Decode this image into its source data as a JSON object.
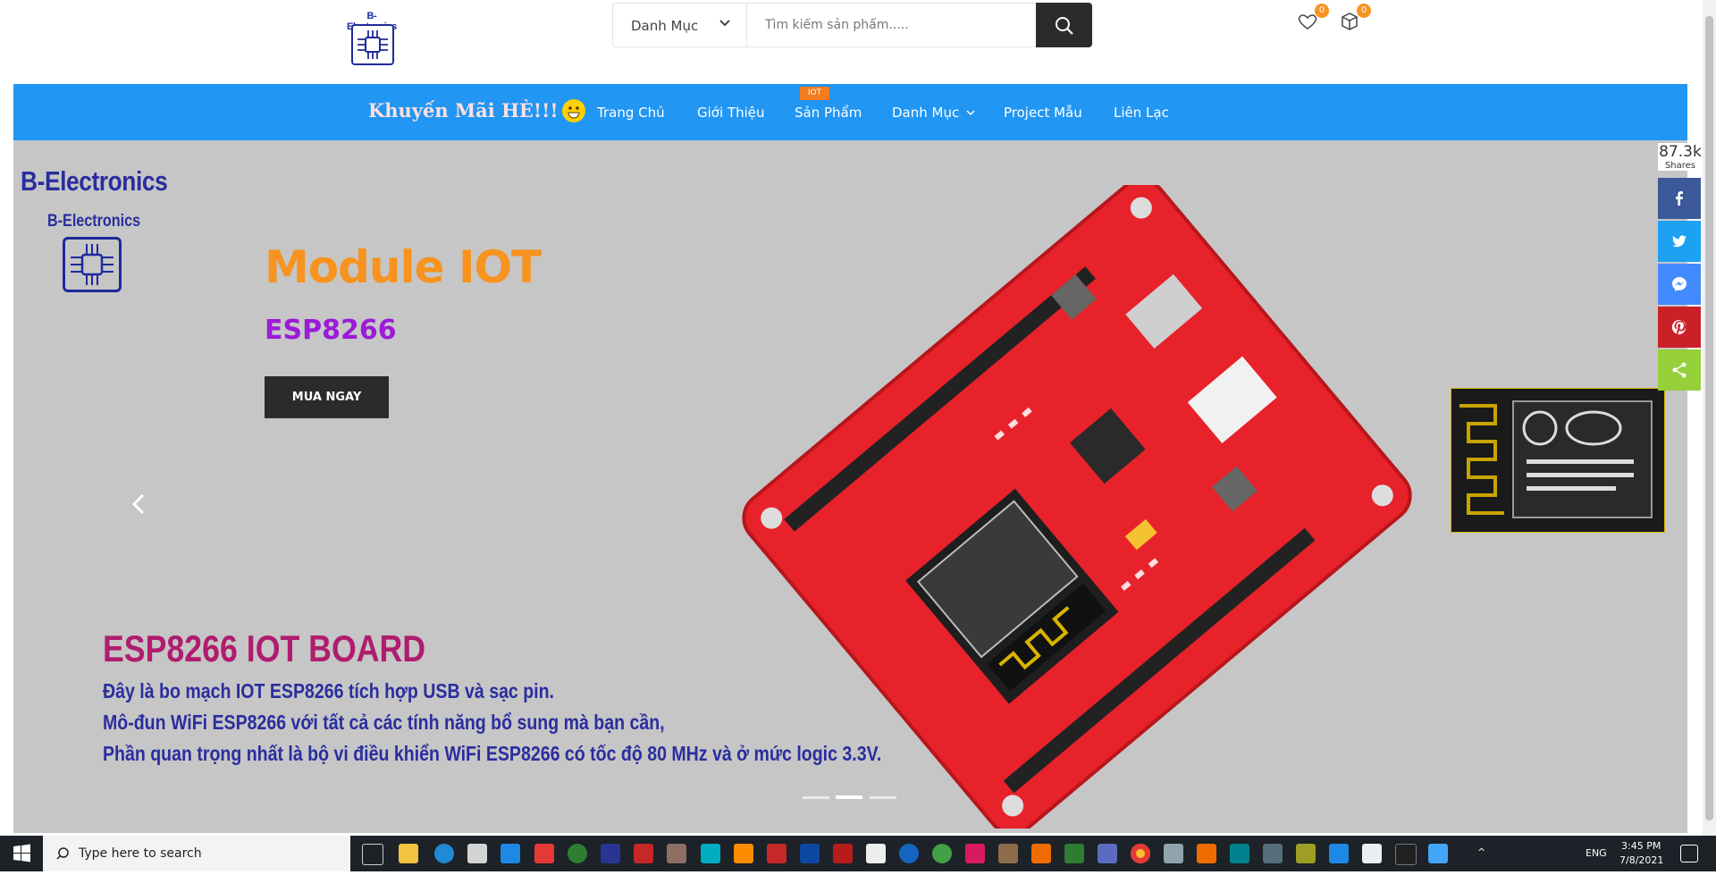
{
  "header": {
    "logo_text": "B-Electronics",
    "category_label": "Danh Mục",
    "search_placeholder": "Tìm kiếm sản phẩm.....",
    "wishlist_count": "0",
    "cart_count": "0"
  },
  "nav": {
    "promo": "Khuyến Mãi HÈ!!!",
    "items": [
      {
        "label": "Trang Chủ"
      },
      {
        "label": "Giới Thiệu"
      },
      {
        "label": "Sản Phẩm",
        "tag": "IOT"
      },
      {
        "label": "Danh Mục"
      },
      {
        "label": "Project Mẫu"
      },
      {
        "label": "Liên Lạc"
      }
    ]
  },
  "hero": {
    "brand_large": "B-Electronics",
    "brand_small": "B-Electronics",
    "title": "Module IOT",
    "subtitle": "ESP8266",
    "button": "MUA NGAY",
    "board_title": "ESP8266 IOT BOARD",
    "lines": [
      "Đây là bo mạch IOT ESP8266  tích hợp USB và sạc pin.",
      "Mô-đun WiFi ESP8266 với tất cả các tính năng bổ sung mà bạn cần,",
      "Phần quan trọng nhất là bộ vi điều khiển WiFi ESP8266 có tốc độ 80 MHz và ở mức logic 3.3V."
    ],
    "slides": 3,
    "active_slide": 2
  },
  "share": {
    "count": "87.3k",
    "label": "Shares",
    "buttons": [
      {
        "name": "facebook",
        "color": "#3b5998"
      },
      {
        "name": "twitter",
        "color": "#1da1f2"
      },
      {
        "name": "messenger",
        "color": "#448aff"
      },
      {
        "name": "pinterest",
        "color": "#cb2027"
      },
      {
        "name": "sharethis",
        "color": "#95d03a"
      }
    ]
  },
  "taskbar": {
    "search_text": "Type here to search",
    "time": "3:45 PM",
    "date": "7/8/2021",
    "language": "ENG"
  }
}
